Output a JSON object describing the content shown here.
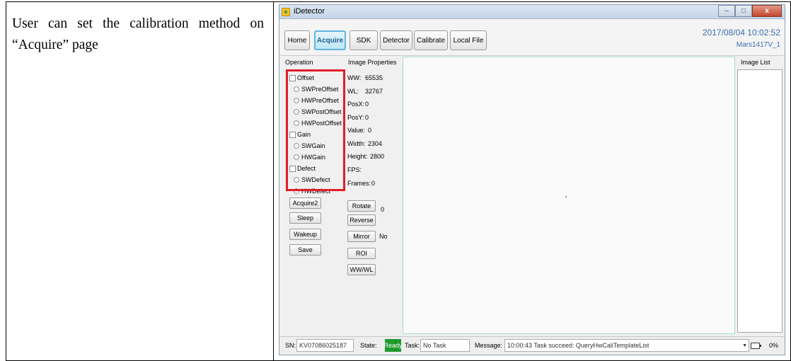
{
  "document": {
    "description": "User can set the calibration method on “Acquire” page"
  },
  "window": {
    "title": "iDetector",
    "controls": {
      "minimize": "–",
      "maximize": "□",
      "close": "x"
    }
  },
  "topbar": {
    "buttons": [
      "Home",
      "Acquire",
      "SDK",
      "Detector",
      "Calibrate",
      "Local File"
    ],
    "active_button": "Acquire",
    "datetime": "2017/08/04 10:02:52",
    "device": "Mars1417V_1"
  },
  "operation": {
    "heading": "Operation",
    "groups": [
      {
        "label": "Offset",
        "options": [
          "SWPreOffset",
          "HWPreOffset",
          "SWPostOffset",
          "HWPostOffset"
        ]
      },
      {
        "label": "Gain",
        "options": [
          "SWGain",
          "HWGain"
        ]
      },
      {
        "label": "Defect",
        "options": [
          "SWDefect",
          "HWDefect"
        ]
      }
    ],
    "buttons": [
      "Acquire2",
      "Sleep",
      "Wakeup",
      "Save"
    ]
  },
  "image_properties": {
    "heading": "Image Properties",
    "fields": [
      {
        "label": "WW:",
        "value": "65535"
      },
      {
        "label": "WL:",
        "value": "32767"
      },
      {
        "label": "PosX:",
        "value": "0"
      },
      {
        "label": "PosY:",
        "value": "0"
      },
      {
        "label": "Value:",
        "value": "0"
      },
      {
        "label": "Width:",
        "value": "2304"
      },
      {
        "label": "Height:",
        "value": "2800"
      },
      {
        "label": "FPS:",
        "value": ""
      },
      {
        "label": "Frames:",
        "value": "0"
      }
    ],
    "buttons": [
      "Rotate",
      "Reverse",
      "Mirror",
      "ROI",
      "WW/WL"
    ],
    "rotate_value": "0",
    "mirror_value": "No"
  },
  "image_list": {
    "heading": "Image List"
  },
  "status": {
    "sn_label": "SN:",
    "sn_value": "KV07086025187",
    "state_label": "State:",
    "state_value": "Ready",
    "task_label": "Task:",
    "task_value": "No Task",
    "message_label": "Message:",
    "message_value": "10:00:43 Task succeed: QueryHwCaliTemplateList",
    "percent": "0%"
  },
  "colors": {
    "highlight_border": "#e01e2a",
    "active_button": "#5fb6e0",
    "ready_state": "#1f9a2e",
    "header_text": "#3a6fb0"
  }
}
